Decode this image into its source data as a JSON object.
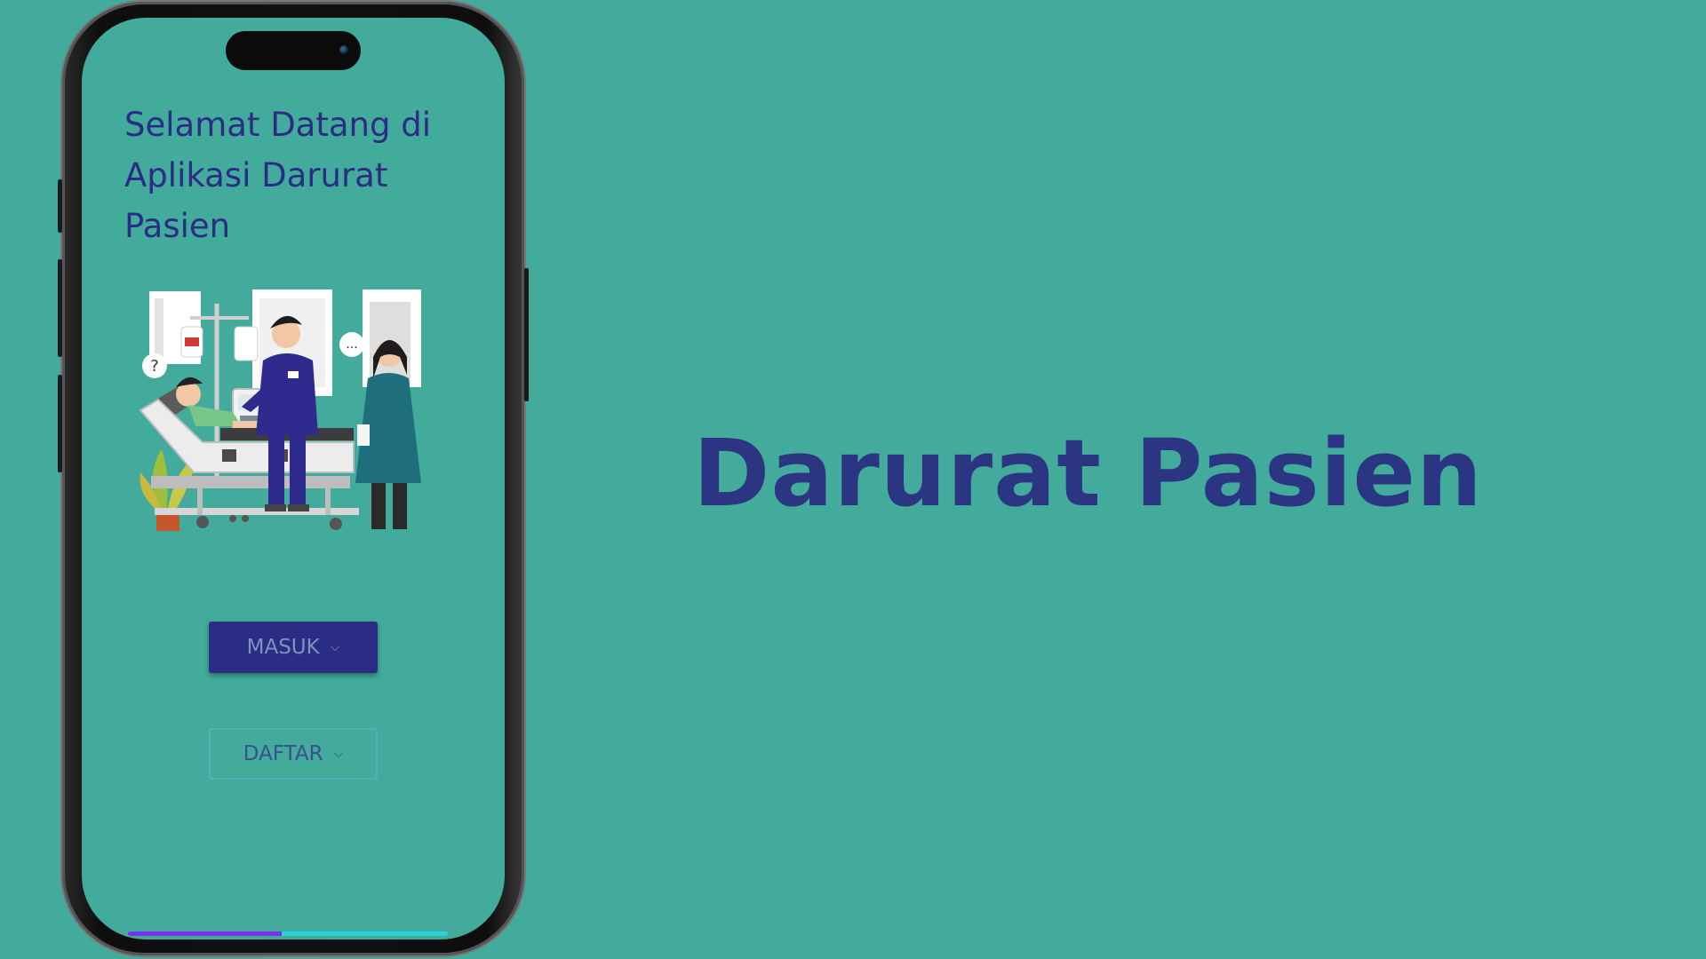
{
  "screen": {
    "welcome_title": "Selamat Datang di Aplikasi Darurat Pasien",
    "buttons": {
      "masuk_label": "MASUK",
      "daftar_label": "DAFTAR"
    },
    "illustration": {
      "question_bubble": "?",
      "speech_bubble": "..."
    }
  },
  "banner": {
    "title": "Darurat Pasien"
  },
  "colors": {
    "background": "#42ab9b",
    "primary": "#2b2c84",
    "title": "#2b3582"
  },
  "icons": [
    "chevron-down-icon"
  ]
}
